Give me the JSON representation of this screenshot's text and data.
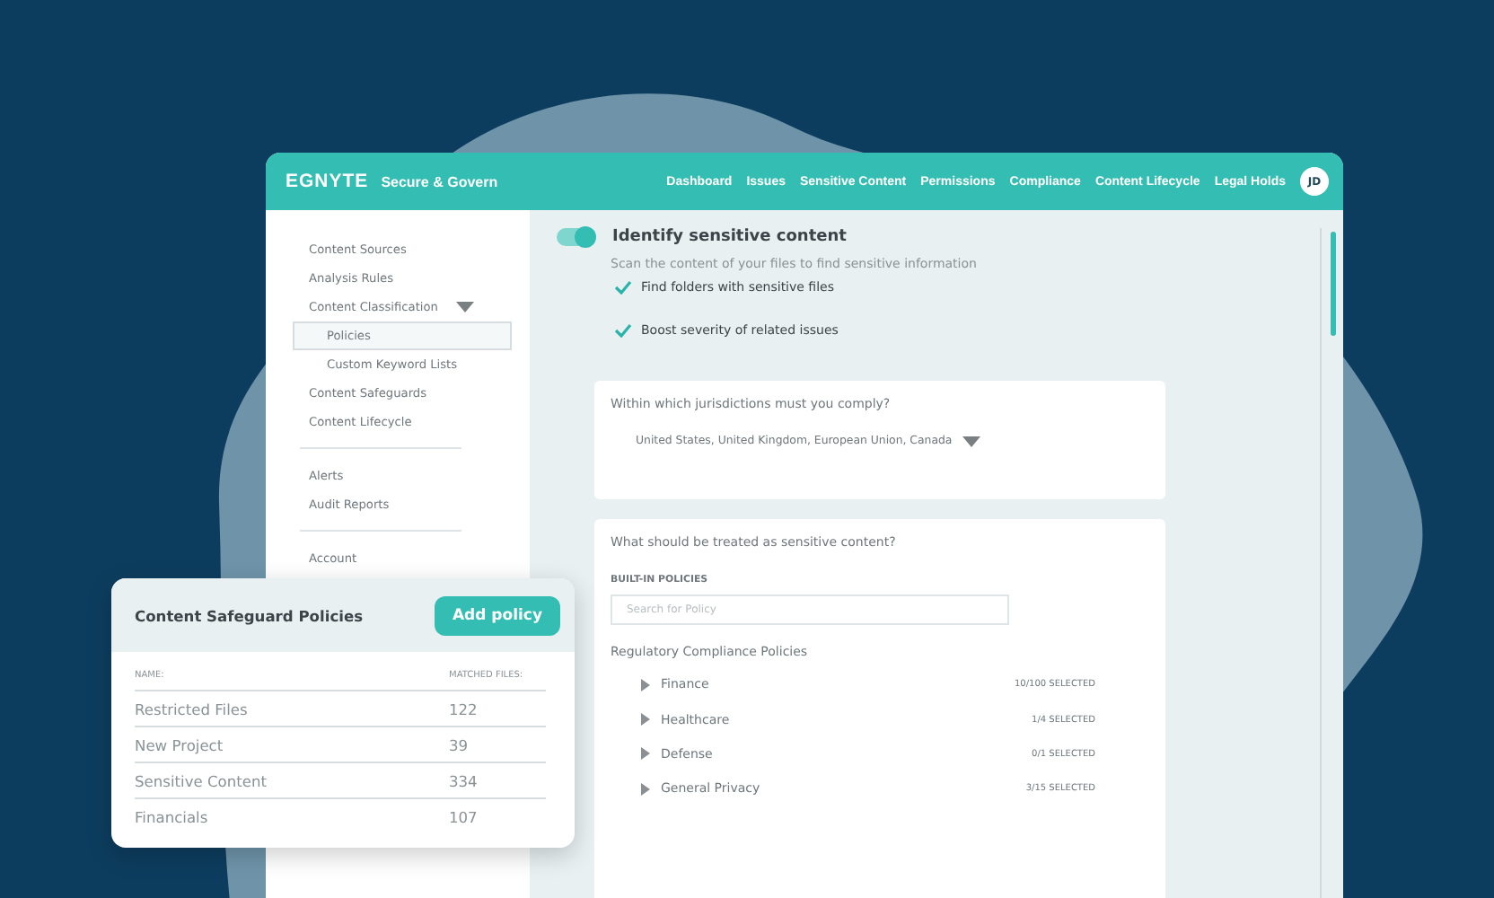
{
  "header": {
    "logo": "EGNYTE",
    "product": "Secure & Govern",
    "nav": [
      "Dashboard",
      "Issues",
      "Sensitive Content",
      "Permissions",
      "Compliance",
      "Content Lifecycle",
      "Legal Holds"
    ],
    "avatar": "JD"
  },
  "sidebar": {
    "groups": [
      {
        "items": [
          {
            "label": "Content Sources",
            "selected": false
          },
          {
            "label": "Analysis Rules",
            "selected": false
          },
          {
            "label": "Content Classification",
            "selected": false,
            "expanded": true,
            "children": [
              {
                "label": "Policies",
                "selected": true
              },
              {
                "label": "Custom Keyword Lists",
                "selected": false
              }
            ]
          },
          {
            "label": "Content Safeguards",
            "selected": false
          },
          {
            "label": "Content Lifecycle",
            "selected": false
          }
        ]
      },
      {
        "items": [
          {
            "label": "Alerts",
            "selected": false
          },
          {
            "label": "Audit Reports",
            "selected": false
          }
        ]
      },
      {
        "items": [
          {
            "label": "Account",
            "selected": false
          }
        ]
      }
    ]
  },
  "main": {
    "toggle": {
      "label": "Identify sensitive content",
      "on": true
    },
    "description": "Scan the content of your files to find sensitive information",
    "options": [
      {
        "label": "Find folders with sensitive files",
        "checked": true
      },
      {
        "label": "Boost severity of related issues",
        "checked": true
      }
    ],
    "jurisdictions": {
      "question": "Within which jurisdictions must you comply?",
      "value": "United States, United Kingdom, European Union, Canada"
    },
    "sensitive": {
      "question": "What should be treated as sensitive content?",
      "section_label": "BUILT-IN POLICIES",
      "search": {
        "placeholder": "Search for Policy"
      },
      "subheading": "Regulatory Compliance Policies",
      "categories": [
        {
          "name": "Finance",
          "count": "10/100 SELECTED",
          "expanded": false
        },
        {
          "name": "Healthcare",
          "count": "1/4 SELECTED",
          "expanded": false
        },
        {
          "name": "Defense",
          "count": "0/1 SELECTED",
          "expanded": false
        },
        {
          "name": "General Privacy",
          "count": "3/15 SELECTED",
          "expanded": false
        }
      ]
    }
  },
  "policy_card": {
    "title": "Content Safeguard Policies",
    "button": "Add policy",
    "columns": [
      "NAME:",
      "MATCHED FILES:"
    ],
    "rows": [
      [
        "Restricted Files",
        "122"
      ],
      [
        "New Project",
        "39"
      ],
      [
        "Sensitive Content",
        "334"
      ],
      [
        "Financials",
        "107"
      ]
    ]
  }
}
